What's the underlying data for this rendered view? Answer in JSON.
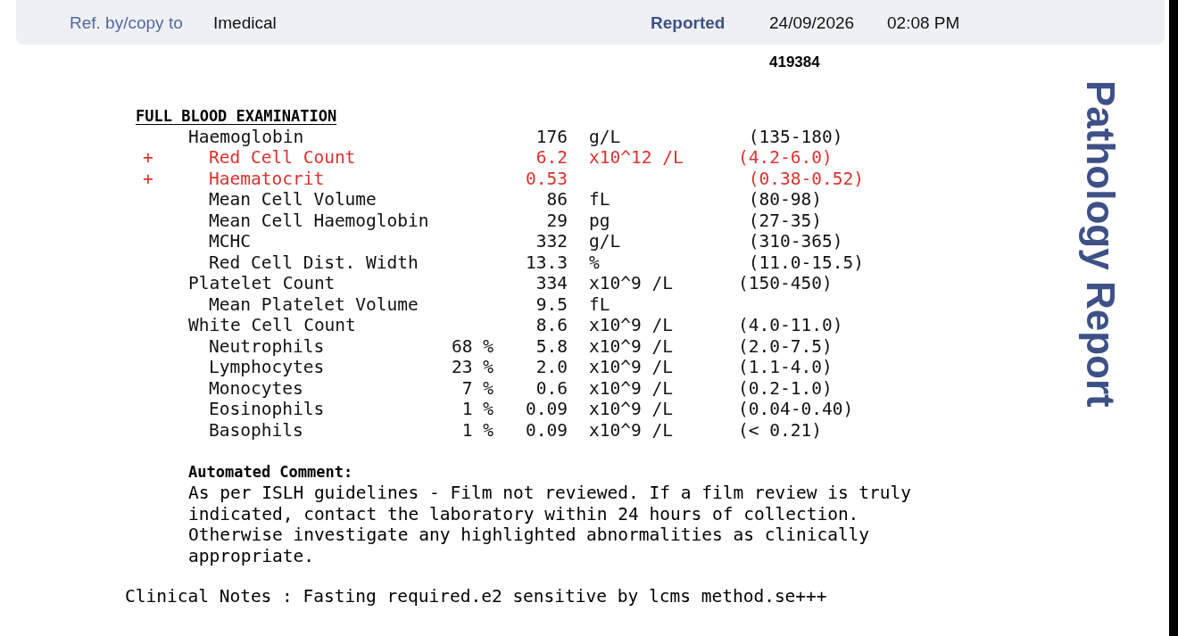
{
  "header": {
    "referral": {
      "label": "Ref. by/copy to",
      "value": "Imedical"
    },
    "reported": {
      "label": "Reported",
      "date": "24/09/2026",
      "time": "02:08 PM"
    },
    "lab_number": "419384"
  },
  "side_title": "Pathology Report",
  "section": {
    "title": "FULL BLOOD EXAMINATION",
    "rows": [
      {
        "name": "Haemoglobin",
        "value": "176",
        "unit": "g/L",
        "range": " (135-180)",
        "abnormal": false,
        "children": [
          {
            "name": "Red Cell Count",
            "flag": "+",
            "value": "6.2",
            "unit": "x10^12 /L",
            "range": "(4.2-6.0)",
            "abnormal": true
          },
          {
            "name": "Haematocrit",
            "flag": "+",
            "value": "0.53",
            "range": " (0.38-0.52)",
            "abnormal": true
          },
          {
            "name": "Mean Cell Volume",
            "value": "86",
            "unit": "fL",
            "range": " (80-98)",
            "abnormal": false
          },
          {
            "name": "Mean Cell Haemoglobin",
            "value": "29",
            "unit": "pg",
            "range": " (27-35)",
            "abnormal": false
          },
          {
            "name": "MCHC",
            "value": "332",
            "unit": "g/L",
            "range": " (310-365)",
            "abnormal": false
          },
          {
            "name": "Red Cell Dist. Width",
            "value": "13.3",
            "unit": "%",
            "range": " (11.0-15.5)",
            "abnormal": false
          }
        ]
      },
      {
        "name": "Platelet Count",
        "value": "334",
        "unit": "x10^9 /L",
        "range": "(150-450)",
        "abnormal": false,
        "children": [
          {
            "name": "Mean Platelet Volume",
            "value": "9.5",
            "unit": "fL",
            "abnormal": false
          }
        ]
      },
      {
        "name": "White Cell Count",
        "value": "8.6",
        "unit": "x10^9 /L",
        "range": "(4.0-11.0)",
        "abnormal": false,
        "children": [
          {
            "name": "Neutrophils",
            "percent": "68 %",
            "value": "5.8",
            "unit": "x10^9 /L",
            "range": "(2.0-7.5)",
            "abnormal": false
          },
          {
            "name": "Lymphocytes",
            "percent": "23 %",
            "value": "2.0",
            "unit": "x10^9 /L",
            "range": "(1.1-4.0)",
            "abnormal": false
          },
          {
            "name": "Monocytes",
            "percent": "7 %",
            "value": "0.6",
            "unit": "x10^9 /L",
            "range": "(0.2-1.0)",
            "abnormal": false
          },
          {
            "name": "Eosinophils",
            "percent": "1 %",
            "value": "0.09",
            "unit": "x10^9 /L",
            "range": "(0.04-0.40)",
            "abnormal": false
          },
          {
            "name": "Basophils",
            "percent": "1 %",
            "value": "0.09",
            "unit": "x10^9 /L",
            "range": "(< 0.21)",
            "abnormal": false
          }
        ]
      }
    ]
  },
  "comment": {
    "title": "Automated Comment:",
    "text": "As per ISLH guidelines - Film not reviewed. If a film review is truly\nindicated, contact the laboratory within 24 hours of collection.\nOtherwise investigate any highlighted abnormalities as clinically\nappropriate."
  },
  "clinical_notes": "Clinical Notes : Fasting required.e2 sensitive by lcms method.se+++"
}
